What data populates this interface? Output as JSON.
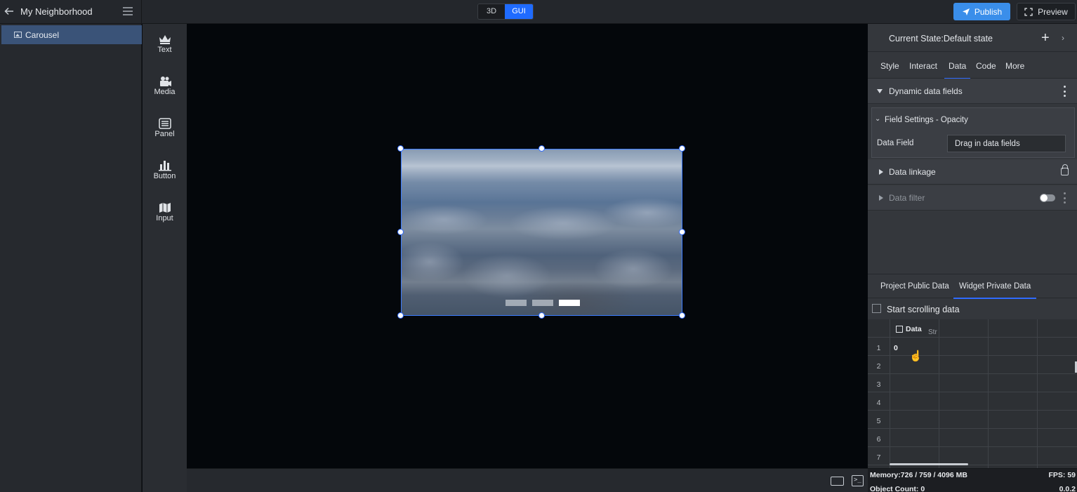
{
  "topbar": {
    "project_title": "My Neighborhood",
    "mode_3d": "3D",
    "mode_gui": "GUI",
    "publish": "Publish",
    "preview": "Preview",
    "accent": "#1f6bff"
  },
  "layers": {
    "items": [
      {
        "label": "Carousel",
        "icon": "image-icon",
        "selected": true
      }
    ]
  },
  "toolbar": {
    "tools": [
      {
        "label": "Text",
        "icon": "crown-icon"
      },
      {
        "label": "Media",
        "icon": "camera-icon"
      },
      {
        "label": "Panel",
        "icon": "panel-list-icon"
      },
      {
        "label": "Button",
        "icon": "bar-chart-icon"
      },
      {
        "label": "Input",
        "icon": "map-icon"
      }
    ]
  },
  "canvas": {
    "carousel_pages": 3,
    "carousel_active_page": 3
  },
  "props": {
    "state_title": "Current State:Default state",
    "add_label": "+",
    "tabs": [
      "Style",
      "Interact",
      "Data",
      "Code",
      "More"
    ],
    "active_tab": "Data",
    "dynamic_fields": "Dynamic data fields",
    "field_settings": "Field Settings - Opacity",
    "data_field_label": "Data Field",
    "data_field_placeholder": "Drag in data fields",
    "data_linkage": "Data linkage",
    "data_filter": "Data filter",
    "data_tabs": [
      "Project Public Data",
      "Widget Private Data"
    ],
    "active_data_tab": "Widget Private Data",
    "start_scrolling": "Start scrolling data",
    "grid": {
      "col_header": "Data",
      "col_header2": "Str",
      "rows": [
        "1",
        "2",
        "3",
        "4",
        "5",
        "6",
        "7"
      ],
      "first_value": "0"
    }
  },
  "status": {
    "memory": "Memory:726 / 759 / 4096 MB",
    "fps": "FPS: 59",
    "object_count": "Object Count: 0",
    "version": "0.0.2"
  }
}
